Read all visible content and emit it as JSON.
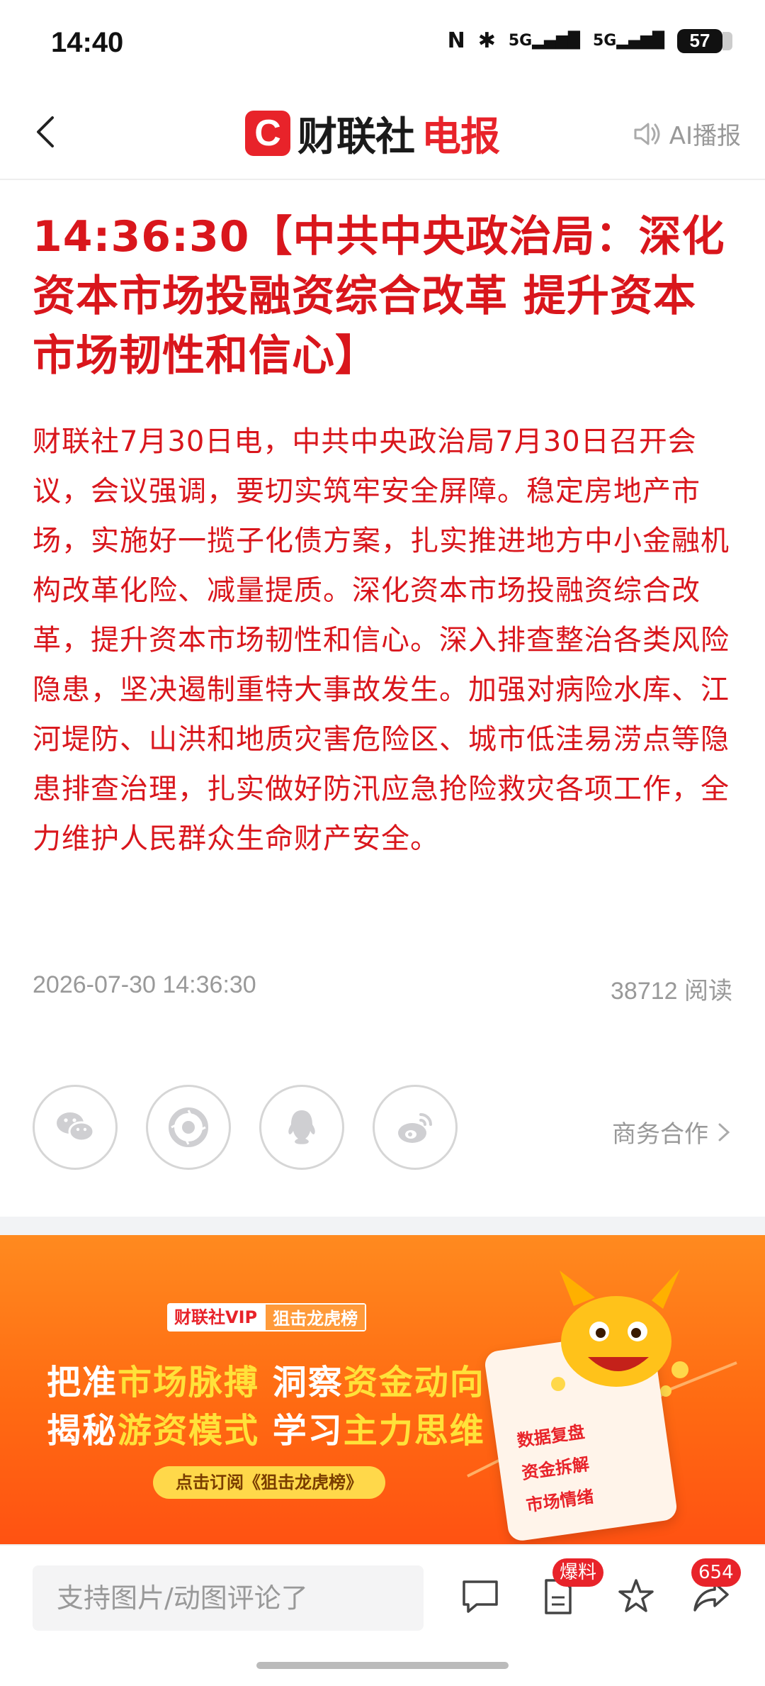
{
  "status_bar": {
    "time": "14:40",
    "nfc": "N",
    "bluetooth": "✱",
    "sim1": "5G",
    "sim2": "5G",
    "battery": "57"
  },
  "nav": {
    "brand_c": "C",
    "brand_part1": "财联社",
    "brand_part2": "电报",
    "ai_label": "AI播报"
  },
  "article": {
    "headline": "14:36:30【中共中央政治局：深化资本市场投融资综合改革 提升资本市场韧性和信心】",
    "body": "财联社7月30日电，中共中央政治局7月30日召开会议，会议强调，要切实筑牢安全屏障。稳定房地产市场，实施好一揽子化债方案，扎实推进地方中小金融机构改革化险、减量提质。深化资本市场投融资综合改革，提升资本市场韧性和信心。深入排查整治各类风险隐患，坚决遏制重特大事故发生。加强对病险水库、江河堤防、山洪和地质灾害危险区、城市低洼易涝点等隐患排查治理，扎实做好防汛应急抢险救灾各项工作，全力维护人民群众生命财产安全。",
    "datetime": "2026-07-30 14:36:30",
    "read_count": "38712 阅读"
  },
  "share": {
    "icons": [
      "wechat-icon",
      "moments-icon",
      "qq-icon",
      "weibo-icon"
    ],
    "business_label": "商务合作"
  },
  "banner": {
    "tag1": "财联社VIP",
    "tag2": "狙击龙虎榜",
    "line1_a": "把准",
    "line1_b": "市场脉搏",
    "line1_c": " 洞察",
    "line1_d": "资金动向",
    "line2_a": "揭秘",
    "line2_b": "游资模式",
    "line2_c": " 学习",
    "line2_d": "主力思维",
    "cta": "点击订阅《狙击龙虎榜》",
    "card_items": [
      "数据复盘",
      "资金拆解",
      "市场情绪"
    ]
  },
  "bottom": {
    "comment_placeholder": "支持图片/动图评论了",
    "baoliao_badge": "爆料",
    "share_count": "654"
  },
  "colors": {
    "accent": "#e8232a",
    "text_red": "#d9161c",
    "banner_orange": "#ff6a12",
    "highlight": "#ffe23a"
  }
}
